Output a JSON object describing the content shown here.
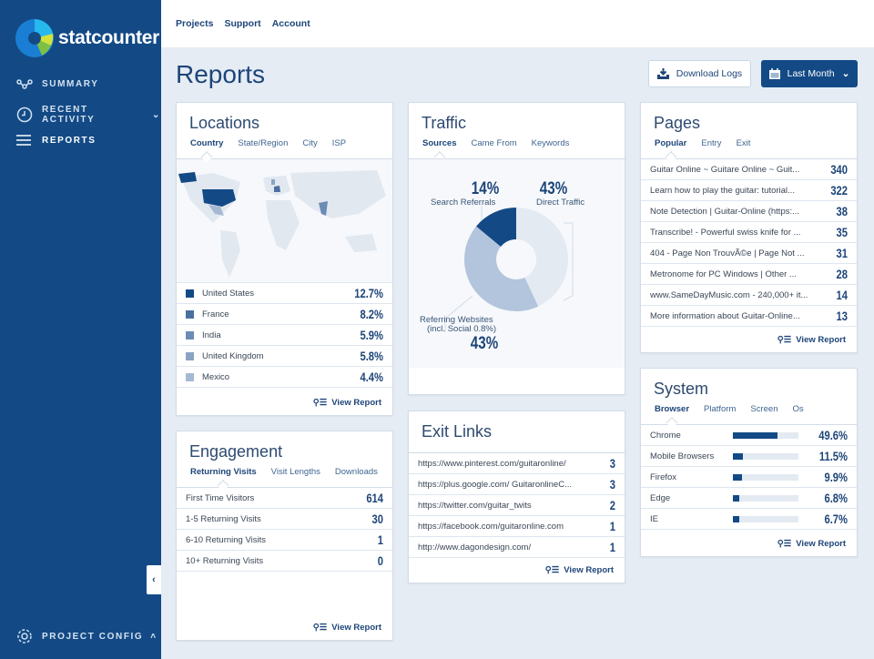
{
  "brand": "statcounter",
  "sidebar": {
    "items": [
      {
        "label": "SUMMARY",
        "icon": "summary-icon"
      },
      {
        "label": "RECENT ACTIVITY",
        "icon": "clock-icon"
      },
      {
        "label": "REPORTS",
        "icon": "list-icon"
      }
    ],
    "footer": "PROJECT CONFIG"
  },
  "topnav": [
    "Projects",
    "Support",
    "Account"
  ],
  "page_title": "Reports",
  "actions": {
    "download": "Download Logs",
    "range": "Last Month"
  },
  "colors": {
    "primary": "#134a86",
    "background": "#e5ecf4"
  },
  "locations": {
    "title": "Locations",
    "tabs": [
      "Country",
      "State/Region",
      "City",
      "ISP"
    ],
    "rows": [
      {
        "label": "United States",
        "value": "12.7%",
        "color": "#134a86"
      },
      {
        "label": "France",
        "value": "8.2%",
        "color": "#4a6fa0"
      },
      {
        "label": "India",
        "value": "5.9%",
        "color": "#6c8bb5"
      },
      {
        "label": "United Kingdom",
        "value": "5.8%",
        "color": "#8aa3c5"
      },
      {
        "label": "Mexico",
        "value": "4.4%",
        "color": "#a6b9d3"
      }
    ],
    "view": "View Report"
  },
  "traffic": {
    "title": "Traffic",
    "tabs": [
      "Sources",
      "Came From",
      "Keywords"
    ],
    "segments": [
      {
        "label": "Direct Traffic",
        "value": "43%",
        "pct": 43,
        "color": "#e4eaf2"
      },
      {
        "label": "Referring Websites",
        "sub": "(incl. Social 0.8%)",
        "value": "43%",
        "pct": 43,
        "color": "#b3c5dc"
      },
      {
        "label": "Search Referrals",
        "value": "14%",
        "pct": 14,
        "color": "#134a86"
      }
    ]
  },
  "pages": {
    "title": "Pages",
    "tabs": [
      "Popular",
      "Entry",
      "Exit"
    ],
    "rows": [
      {
        "label": "Guitar Online ~ Guitare Online ~ Guit...",
        "value": "340"
      },
      {
        "label": "Learn how to play the guitar: tutorial...",
        "value": "322"
      },
      {
        "label": "Note Detection | Guitar-Online (https:...",
        "value": "38"
      },
      {
        "label": "Transcribe! - Powerful swiss knife for ...",
        "value": "35"
      },
      {
        "label": "404 - Page Non TrouvÃ©e | Page Not ...",
        "value": "31"
      },
      {
        "label": "Metronome for PC Windows | Other ...",
        "value": "28"
      },
      {
        "label": "www.SameDayMusic.com - 240,000+ it...",
        "value": "14"
      },
      {
        "label": "More information about Guitar-Online...",
        "value": "13"
      }
    ],
    "view": "View Report"
  },
  "engagement": {
    "title": "Engagement",
    "tabs": [
      "Returning Visits",
      "Visit Lengths",
      "Downloads"
    ],
    "rows": [
      {
        "label": "First Time Visitors",
        "value": "614"
      },
      {
        "label": "1-5 Returning Visits",
        "value": "30"
      },
      {
        "label": "6-10 Returning Visits",
        "value": "1"
      },
      {
        "label": "10+ Returning Visits",
        "value": "0"
      }
    ],
    "view": "View Report"
  },
  "exit": {
    "title": "Exit Links",
    "rows": [
      {
        "label": "https://www.pinterest.com/guitaronline/",
        "value": "3"
      },
      {
        "label": "https://plus.google.com/ GuitaronlineC...",
        "value": "3"
      },
      {
        "label": "https://twitter.com/guitar_twits",
        "value": "2"
      },
      {
        "label": "https://facebook.com/guitaronline.com",
        "value": "1"
      },
      {
        "label": "http://www.dagondesign.com/",
        "value": "1"
      }
    ],
    "view": "View Report"
  },
  "system": {
    "title": "System",
    "tabs": [
      "Browser",
      "Platform",
      "Screen",
      "Os"
    ],
    "rows": [
      {
        "label": "Chrome",
        "value": "49.6%",
        "pct": 49.6
      },
      {
        "label": "Mobile Browsers",
        "value": "11.5%",
        "pct": 11.5
      },
      {
        "label": "Firefox",
        "value": "9.9%",
        "pct": 9.9
      },
      {
        "label": "Edge",
        "value": "6.8%",
        "pct": 6.8
      },
      {
        "label": "IE",
        "value": "6.7%",
        "pct": 6.7
      }
    ],
    "view": "View Report"
  }
}
